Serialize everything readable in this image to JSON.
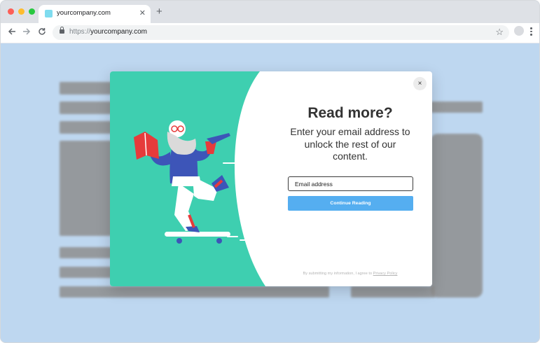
{
  "browser": {
    "tab_title": "yourcompany.com",
    "tab_close_icon": "close-icon",
    "new_tab_symbol": "+",
    "url_scheme": "https://",
    "url_host": "yourcompany.com",
    "colors": {
      "chrome": "#dee1e6",
      "favicon": "#7fdcef"
    }
  },
  "modal": {
    "close_symbol": "×",
    "heading": "Read more?",
    "subtext": "Enter your email address to unlock the rest of our content.",
    "email_placeholder": "Email address",
    "cta_label": "Continue Reading",
    "consent_text": "By submitting my information, I agree to ",
    "consent_link": "Privacy Policy",
    "colors": {
      "art_background": "#3ecfb0",
      "cta": "#55aef0",
      "heading": "#333333"
    }
  }
}
